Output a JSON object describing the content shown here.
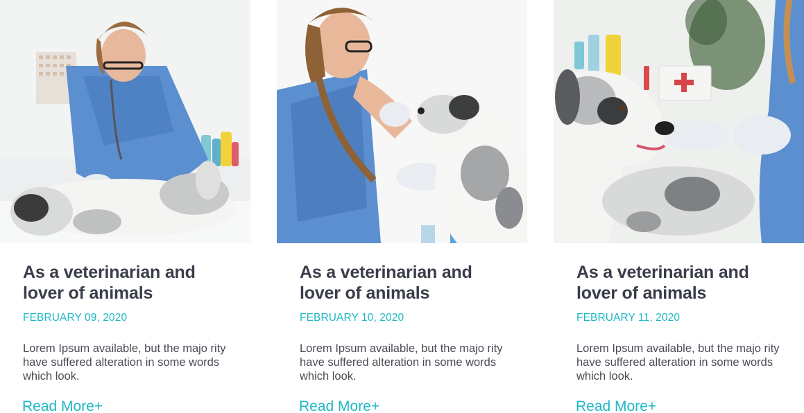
{
  "posts": [
    {
      "image_alt": "Veterinarian examining a dog with a stethoscope",
      "title": "As a veterinarian and lover of animals",
      "date": "FEBRUARY 09, 2020",
      "excerpt": "Lorem Ipsum available, but the majo rity have suffered alteration in some words which look.",
      "read_more": "Read More+"
    },
    {
      "image_alt": "Smiling veterinarian holding a dog's paw",
      "title": "As a veterinarian and lover of animals",
      "date": "FEBRUARY 10, 2020",
      "excerpt": "Lorem Ipsum available, but the majo rity have suffered alteration in some words which look.",
      "read_more": "Read More+"
    },
    {
      "image_alt": "Veterinarian feeding a treat to a dog",
      "title": "As a veterinarian and lover of animals",
      "date": "FEBRUARY 11, 2020",
      "excerpt": "Lorem Ipsum available, but the majo rity have suffered alteration in some words which look.",
      "read_more": "Read More+"
    }
  ],
  "colors": {
    "accent": "#1db8c4",
    "heading": "#3a3d4a",
    "body": "#4a4c55",
    "scrubs": "#5b8fd0"
  }
}
